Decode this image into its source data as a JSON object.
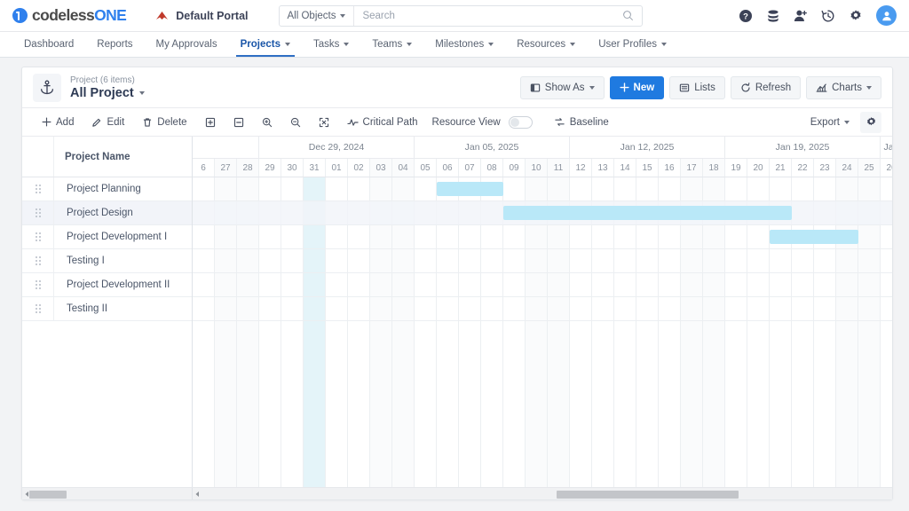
{
  "topbar": {
    "logo_text_a": "codeless",
    "logo_text_b": "ONE",
    "portal_name": "Default Portal",
    "object_filter": "All Objects",
    "search_placeholder": "Search",
    "icons": [
      "help-icon",
      "database-icon",
      "add-user-icon",
      "history-icon",
      "gear-icon",
      "avatar"
    ]
  },
  "nav": {
    "items": [
      {
        "label": "Dashboard",
        "has_caret": false,
        "active": false
      },
      {
        "label": "Reports",
        "has_caret": false,
        "active": false
      },
      {
        "label": "My Approvals",
        "has_caret": false,
        "active": false
      },
      {
        "label": "Projects",
        "has_caret": true,
        "active": true
      },
      {
        "label": "Tasks",
        "has_caret": true,
        "active": false
      },
      {
        "label": "Teams",
        "has_caret": true,
        "active": false
      },
      {
        "label": "Milestones",
        "has_caret": true,
        "active": false
      },
      {
        "label": "Resources",
        "has_caret": true,
        "active": false
      },
      {
        "label": "User Profiles",
        "has_caret": true,
        "active": false
      }
    ]
  },
  "card_header": {
    "object_icon": "anchor-icon",
    "subtitle": "Project (6 items)",
    "title": "All Project",
    "buttons": [
      {
        "label": "Show As",
        "icon": "layout-icon",
        "caret": true,
        "primary": false
      },
      {
        "label": "New",
        "icon": "plus-icon",
        "caret": false,
        "primary": true
      },
      {
        "label": "Lists",
        "icon": "list-icon",
        "caret": false,
        "primary": false
      },
      {
        "label": "Refresh",
        "icon": "refresh-icon",
        "caret": false,
        "primary": false
      },
      {
        "label": "Charts",
        "icon": "chart-icon",
        "caret": true,
        "primary": false
      }
    ]
  },
  "toolbar": {
    "left": [
      {
        "label": "Add",
        "icon": "plus-icon"
      },
      {
        "label": "Edit",
        "icon": "pencil-icon"
      },
      {
        "label": "Delete",
        "icon": "trash-icon"
      },
      {
        "label": "",
        "icon": "expand-all-icon"
      },
      {
        "label": "",
        "icon": "collapse-all-icon"
      },
      {
        "label": "",
        "icon": "zoom-in-icon"
      },
      {
        "label": "",
        "icon": "zoom-out-icon"
      },
      {
        "label": "",
        "icon": "fit-screen-icon"
      },
      {
        "label": "Critical Path",
        "icon": "activity-icon"
      }
    ],
    "resource_view_label": "Resource View",
    "resource_view_on": false,
    "baseline_label": "Baseline",
    "baseline_icon": "baseline-icon",
    "export_label": "Export",
    "settings_icon": "gear-icon"
  },
  "gantt": {
    "column_header": "Project Name",
    "weeks": [
      {
        "label": "",
        "days": 3
      },
      {
        "label": "Dec 29, 2024",
        "days": 7
      },
      {
        "label": "Jan 05, 2025",
        "days": 7
      },
      {
        "label": "Jan 12, 2025",
        "days": 7
      },
      {
        "label": "Jan 19, 2025",
        "days": 7
      },
      {
        "label": "Jan",
        "days": 1
      }
    ],
    "days": [
      "6",
      "27",
      "28",
      "29",
      "30",
      "31",
      "01",
      "02",
      "03",
      "04",
      "05",
      "06",
      "07",
      "08",
      "09",
      "10",
      "11",
      "12",
      "13",
      "14",
      "15",
      "16",
      "17",
      "18",
      "19",
      "20",
      "21",
      "22",
      "23",
      "24",
      "25",
      "26"
    ],
    "weekend_indexes": [
      1,
      2,
      8,
      9,
      15,
      16,
      22,
      23,
      29,
      30
    ],
    "today_index": 5,
    "bar_color": "#b9e8f8",
    "tasks": [
      {
        "name": "Project Planning",
        "selected": false,
        "bar": {
          "start_index": 11,
          "span": 3
        }
      },
      {
        "name": "Project Design",
        "selected": true,
        "bar": {
          "start_index": 14,
          "span": 13
        }
      },
      {
        "name": "Project Development I",
        "selected": false,
        "bar": {
          "start_index": 26,
          "span": 4
        }
      },
      {
        "name": "Testing I",
        "selected": false,
        "bar": null
      },
      {
        "name": "Project Development II",
        "selected": false,
        "bar": null
      },
      {
        "name": "Testing II",
        "selected": false,
        "bar": null
      }
    ]
  },
  "scrollbars": {
    "left": {
      "thumb_left_pct": 4,
      "thumb_width_pct": 22
    },
    "right": {
      "thumb_left_pct": 52,
      "thumb_width_pct": 26
    }
  }
}
